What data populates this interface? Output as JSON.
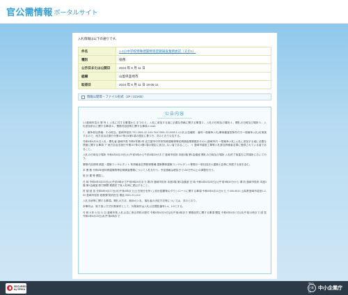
{
  "header": {
    "brand_main": "官公需情報",
    "brand_sub": "ポータルサイト"
  },
  "page": {
    "intro": "入札情報は以下の通りです。"
  },
  "info_table": [
    {
      "label": "件名",
      "value": "1-4小中学校特殊建築物等定期調査業務委託（その1）",
      "link": true
    },
    {
      "label": "種別",
      "value": "役務",
      "link": false
    },
    {
      "label": "公示日または公開日",
      "value": "2024 年 6 月 11 日",
      "link": false
    },
    {
      "label": "組織",
      "value": "山梨県韮崎市",
      "link": false
    },
    {
      "label": "取得日",
      "value": "2024 年 6 月 11 日 19:05:11",
      "link": false
    }
  ],
  "attachment": {
    "label": "情報公開等・ファイル形式（2P / 321KB）"
  },
  "notice": {
    "title": "公告内容",
    "paragraphs": [
      "1-4韮崎市告示 第 号 1. 入札に付する事項から までの 2 。入札に参加する者に必要な資格に関する事項 3 。入札の日時及び場所 4 。開札の日時及び場所 5 。入札参加申込に関する事項 6 。業務内容説明に関する事項 e-mail：",
      "7 。競争参加資格：その他当。韮崎市役所 TEL 0551-22-1111 FAX 0551-22-8305 1-4入札公告種別：番号一般競争入札(事後審査型条件付き一般競争入札)を実施するので、地方自治法施行令第167条の6第1項の規定に基づき、次のとおり公告する。",
      "令和6年6月11日入札・開札者 韮崎市長 令和6年第1号 名古屋市中学校特殊建築物等定期調査業務委託その1 (韮崎市内 一般競争入札) 入札に参加する者に必要な資格に関する事項 ア 地方自治法施行令第167条の4第1項の規定に該当しない者であること。 イ 韮崎市建設工事等入札参加資格者名簿に登録されている者であること。",
      "入札の日時及び場所 令和6年6月25日(火)午前9時から午前9時30分まで 韮崎市役所 本館3階 第1会議室 開札の日時及び場所 入札終了後直ちに同場所において行う。",
      "業務内容説明 調査・建築コンサルタント 有資格者名簿登録業種 建築関係建築コンサルタント業務の一般社団法人建築士会等に所属する者を含む。",
      "本 業 務 令和6年度特殊建築物等定期調査業務について入札を行う。予定価格は税抜きで150万円以上の調整を行う。",
      "設 計 書 等 閲覧し、",
      "日 時 令和6年6月25日(火)午前9時から午前9時30分まで 場 所 韮崎市役所 本館3階 第1会議室 日 時 令和6年6月25日(火)午前9時30分から 場 所 韮崎市役所 本館3階 第1会議室 受付期間 業務完了後入札時に提出すること。",
      "質 疑 回 答 令和6年6月17日(月)午後4時まで(土日祝日を除く) 設計図書等のダウンロードに関する事項 令和6年6月11日から 〒406-8510 山梨県韮崎市若宮1-2-50 韮崎市役所 総務課 契約担当 電話 0551-22-1111",
      "入札手続等に関する事項。開札の方法、無効の入札、落札者の決定方法等については、次のとおり。",
      "本事件は、取り扱い方式対象案件として、対象案件は入札公告閲覧番号1-4。1/2とする。",
      "令 和 6 年 6 月 11 日 韮崎市長 入札公告に係る資料の配付 令和6年6月24日(月)午後4時まで 業務品質に関する事項 閲覧 令和6年6月17日(月)午前11時まで 回 答 令和6年6月20日(木)午後5時まで"
    ]
  },
  "footer": {
    "secured_line1": "SECURED",
    "secured_line2": "by SPIKA",
    "emblem": "中小企業庁",
    "org_name": "中小企業庁"
  }
}
